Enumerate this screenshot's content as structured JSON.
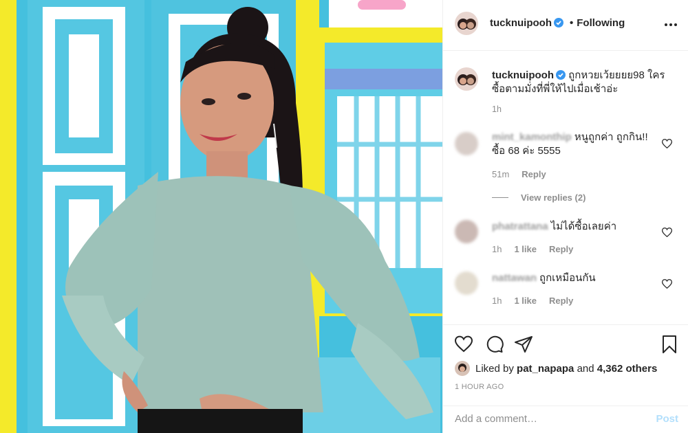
{
  "post": {
    "username": "tucknuipooh",
    "verified": true,
    "follow_status": "Following",
    "more_icon": "more-horizontal-icon"
  },
  "caption": {
    "username": "tucknuipooh",
    "text": "ถูกหวยเว้ยยยย98 ใครซื้อตามมั่งที่พี่ให้ไปเมื่อเช้าอ่ะ",
    "time": "1h"
  },
  "comments": [
    {
      "username": "mint_kamonthip",
      "text": "หนูถูกค่า ถูกกิน!! ซื้อ 68 ค่ะ 5555",
      "time": "51m",
      "likes": "",
      "reply_label": "Reply",
      "view_replies": "View replies (2)"
    },
    {
      "username": "phatrattana",
      "text": "ไม่ได้ซื้อเลยค่า",
      "time": "1h",
      "likes": "1 like",
      "reply_label": "Reply"
    },
    {
      "username": "nattawan",
      "text": "ถูกเหมือนกัน",
      "time": "1h",
      "likes": "1 like",
      "reply_label": "Reply"
    }
  ],
  "actions": {
    "icons": [
      "heart-icon",
      "comment-icon",
      "share-icon",
      "bookmark-icon"
    ]
  },
  "likes": {
    "prefix": "Liked by",
    "user": "pat_napapa",
    "connector": "and",
    "others": "4,362 others"
  },
  "timestamp": "1 HOUR AGO",
  "comment_box": {
    "placeholder": "Add a comment…",
    "post_label": "Post"
  },
  "colors": {
    "link_blue": "#0095f6",
    "post_disabled": "#b2dffc",
    "verified_blue": "#3897f0",
    "muted": "#8e8e8e"
  }
}
